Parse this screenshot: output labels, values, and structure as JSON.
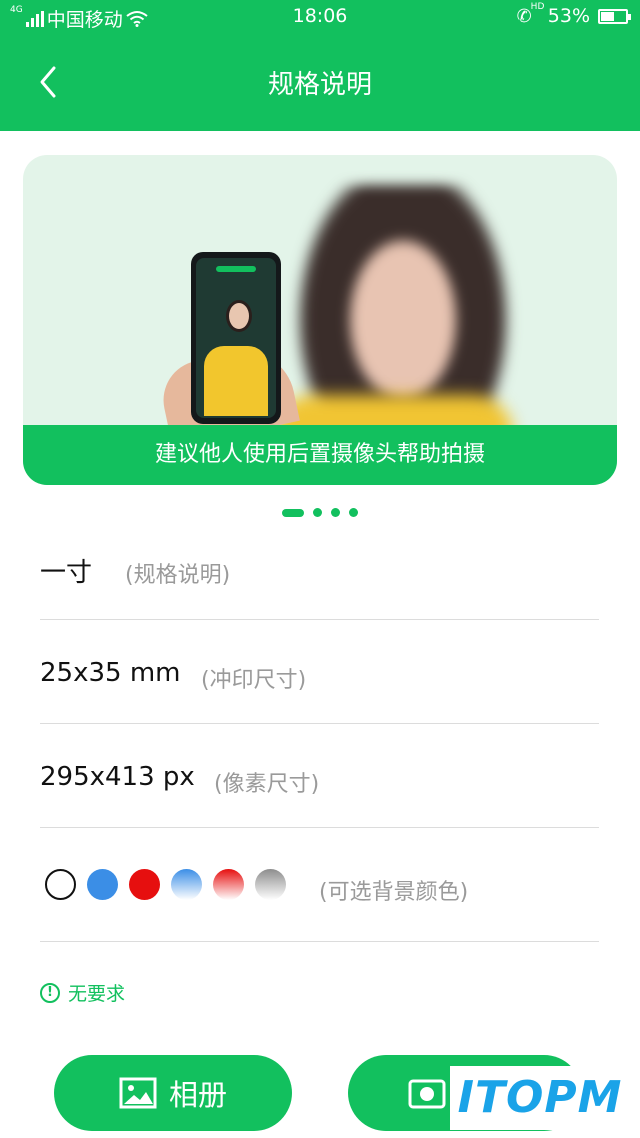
{
  "status_bar": {
    "carrier": "中国移动",
    "network_small": "4G",
    "time": "18:06",
    "call_badge": "HD",
    "battery_percent": "53%",
    "battery_level": 0.53
  },
  "nav": {
    "title": "规格说明",
    "back_icon": "chevron-left-icon"
  },
  "banner": {
    "caption": "建议他人使用后置摄像头帮助拍摄",
    "pager": {
      "total": 4,
      "active": 0
    }
  },
  "specs": [
    {
      "value": "一寸",
      "note": "(规格说明)"
    },
    {
      "value": "25x35 mm",
      "note": "(冲印尺寸)"
    },
    {
      "value": "295x413 px",
      "note": "(像素尺寸)"
    }
  ],
  "background_colors": {
    "label": "(可选背景颜色)",
    "swatches": [
      "white",
      "blue",
      "red",
      "blue-gradient",
      "red-gradient",
      "gray-gradient"
    ]
  },
  "tip": {
    "icon": "exclamation-circle-icon",
    "text": "无要求"
  },
  "buttons": {
    "album": {
      "label": "相册",
      "icon": "image-icon"
    },
    "camera": {
      "icon": "camera-icon"
    }
  },
  "watermark": "ITOPM",
  "colors": {
    "primary": "#12c05e",
    "note_gray": "#9a9a9a",
    "divider": "#dcdcdc"
  }
}
